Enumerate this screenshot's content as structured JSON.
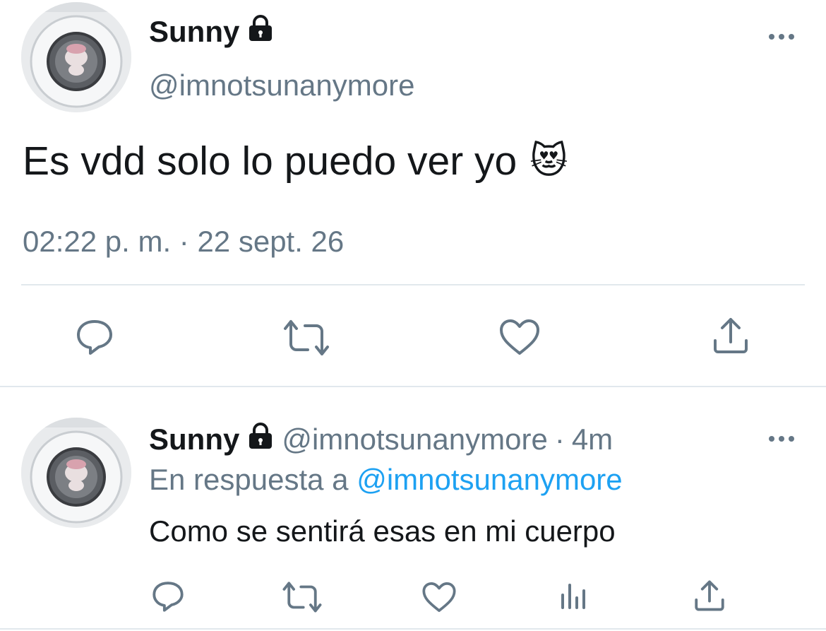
{
  "main_tweet": {
    "author_name": "Sunny",
    "author_handle": "@imnotsunanymore",
    "text": "Es vdd solo lo puedo ver yo",
    "emoji": "😻",
    "timestamp": "02:22 p. m. · 22 sept. 26",
    "icons": {
      "protected": "lock-icon",
      "more": "more-icon",
      "reply": "reply-icon",
      "retweet": "retweet-icon",
      "like": "like-icon",
      "share": "share-icon"
    }
  },
  "reply_tweet": {
    "author_name": "Sunny",
    "author_handle": "@imnotsunanymore",
    "separator": "·",
    "time_ago": "4m",
    "replying_prefix": "En respuesta a",
    "replying_to": "@imnotsunanymore",
    "text": "Como se sentirá esas en mi cuerpo",
    "icons": {
      "protected": "lock-icon",
      "more": "more-icon",
      "reply": "reply-icon",
      "retweet": "retweet-icon",
      "like": "like-icon",
      "analytics": "analytics-icon",
      "share": "share-icon"
    }
  },
  "colors": {
    "text": "#14171a",
    "secondary": "#657786",
    "link": "#1da1f2",
    "divider": "#e1e8ed"
  }
}
